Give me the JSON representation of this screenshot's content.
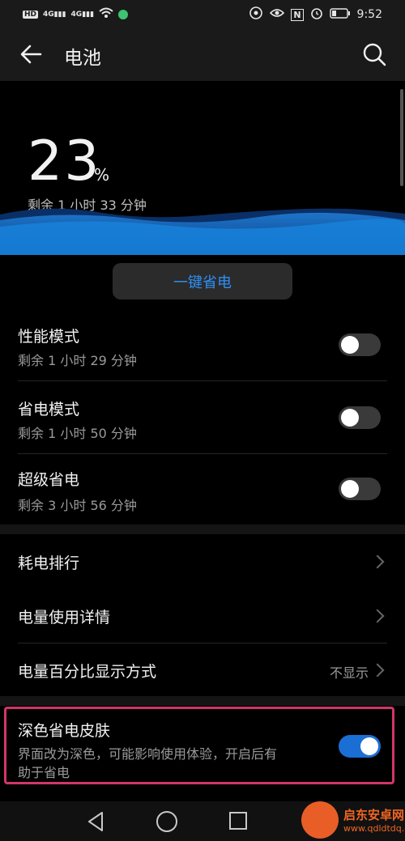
{
  "status": {
    "hd": "HD",
    "sig1": "4G",
    "sig2": "4G",
    "nfc": "N",
    "time": "9:52"
  },
  "header": {
    "title": "电池"
  },
  "hero": {
    "percent": "23",
    "percent_sign": "%",
    "remaining": "剩余 1 小时 33 分钟"
  },
  "one_key_save": "一键省电",
  "modes": [
    {
      "title": "性能模式",
      "sub": "剩余 1 小时 29 分钟",
      "on": false
    },
    {
      "title": "省电模式",
      "sub": "剩余 1 小时 50 分钟",
      "on": false
    },
    {
      "title": "超级省电",
      "sub": "剩余 3 小时 56 分钟",
      "on": false
    }
  ],
  "items": {
    "ranking": "耗电排行",
    "details": "电量使用详情",
    "pct_display": "电量百分比显示方式",
    "pct_display_value": "不显示"
  },
  "dark_skin": {
    "title": "深色省电皮肤",
    "desc1": "界面改为深色，可能影响使用体验，开启后有",
    "desc2": "助于省电",
    "on": true
  },
  "watermark": {
    "name": "启东安卓网",
    "url": "www.qdldtdq.com"
  },
  "colors": {
    "accent": "#2e8ff5",
    "highlight": "#d33568",
    "toggle_on": "#1b6ed4"
  }
}
